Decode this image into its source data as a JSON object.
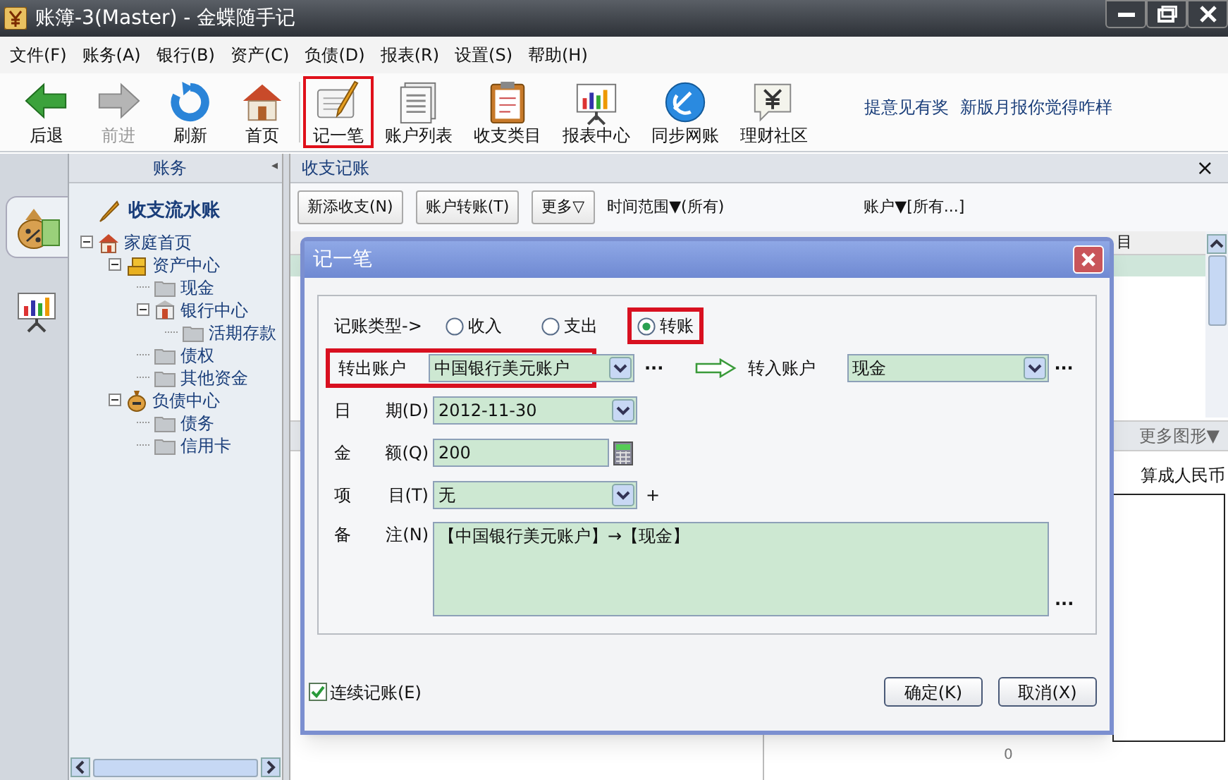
{
  "window": {
    "title": "账簿-3(Master) - 金蝶随手记"
  },
  "menu": [
    "文件(F)",
    "账务(A)",
    "银行(B)",
    "资产(C)",
    "负债(D)",
    "报表(R)",
    "设置(S)",
    "帮助(H)"
  ],
  "toolbar": [
    {
      "label": "后退",
      "disabled": false,
      "highlighted": false
    },
    {
      "label": "前进",
      "disabled": true,
      "highlighted": false
    },
    {
      "label": "刷新",
      "disabled": false,
      "highlighted": false
    },
    {
      "label": "首页",
      "disabled": false,
      "highlighted": false
    },
    {
      "label": "记一笔",
      "disabled": false,
      "highlighted": true
    },
    {
      "label": "账户列表",
      "disabled": false,
      "highlighted": false
    },
    {
      "label": "收支类目",
      "disabled": false,
      "highlighted": false
    },
    {
      "label": "报表中心",
      "disabled": false,
      "highlighted": false
    },
    {
      "label": "同步网账",
      "disabled": false,
      "highlighted": false
    },
    {
      "label": "理财社区",
      "disabled": false,
      "highlighted": false
    }
  ],
  "toolbar_links": [
    "提意见有奖",
    "新版月报你觉得咋样"
  ],
  "sidebar": {
    "header": "账务",
    "collapse": "◂",
    "tabs": [
      {
        "selected": true
      },
      {
        "selected": false
      }
    ],
    "title": "收支流水账",
    "tree": [
      {
        "label": "家庭首页",
        "kind": "home",
        "expanded": true,
        "children": [
          {
            "label": "资产中心",
            "kind": "assets",
            "expanded": true,
            "children": [
              {
                "label": "现金",
                "kind": "folder"
              },
              {
                "label": "银行中心",
                "kind": "bank",
                "expanded": true,
                "children": [
                  {
                    "label": "活期存款",
                    "kind": "folder"
                  }
                ]
              },
              {
                "label": "债权",
                "kind": "folder"
              },
              {
                "label": "其他资金",
                "kind": "folder"
              }
            ]
          },
          {
            "label": "负债中心",
            "kind": "liability",
            "expanded": true,
            "children": [
              {
                "label": "债务",
                "kind": "folder"
              },
              {
                "label": "信用卡",
                "kind": "folder"
              }
            ]
          }
        ]
      }
    ]
  },
  "panel": {
    "title": "收支记账",
    "close": "×",
    "buttons": [
      "新添收支(N)",
      "账户转账(T)",
      "更多▽"
    ],
    "filters": [
      "时间范围▼(所有)",
      "账户▼[所有...]"
    ],
    "column_3": "目",
    "more_charts": "更多图形▼",
    "chart_note": "算成人民币",
    "axis_label": "0"
  },
  "dialog": {
    "title": "记一笔",
    "type_label": "记账类型->",
    "types": [
      {
        "label": "收入",
        "selected": false,
        "highlighted": false
      },
      {
        "label": "支出",
        "selected": false,
        "highlighted": false
      },
      {
        "label": "转账",
        "selected": true,
        "highlighted": true
      }
    ],
    "from_account": {
      "label": "转出账户",
      "value": "中国银行美元账户",
      "highlighted": true,
      "more": "···"
    },
    "to_account": {
      "label": "转入账户",
      "value": "现金",
      "more": "···"
    },
    "date": {
      "label": [
        "日",
        "期(D)"
      ],
      "value": "2012-11-30"
    },
    "amount": {
      "label": [
        "金",
        "额(Q)"
      ],
      "value": "200"
    },
    "item": {
      "label": [
        "项",
        "目(T)"
      ],
      "value": "无",
      "add": "+"
    },
    "note": {
      "label": [
        "备",
        "注(N)"
      ],
      "value": "【中国银行美元账户】→【现金】",
      "more": "···"
    },
    "continuous": {
      "label": "连续记账(E)",
      "checked": true
    },
    "buttons": [
      "确定(K)",
      "取消(X)"
    ]
  }
}
